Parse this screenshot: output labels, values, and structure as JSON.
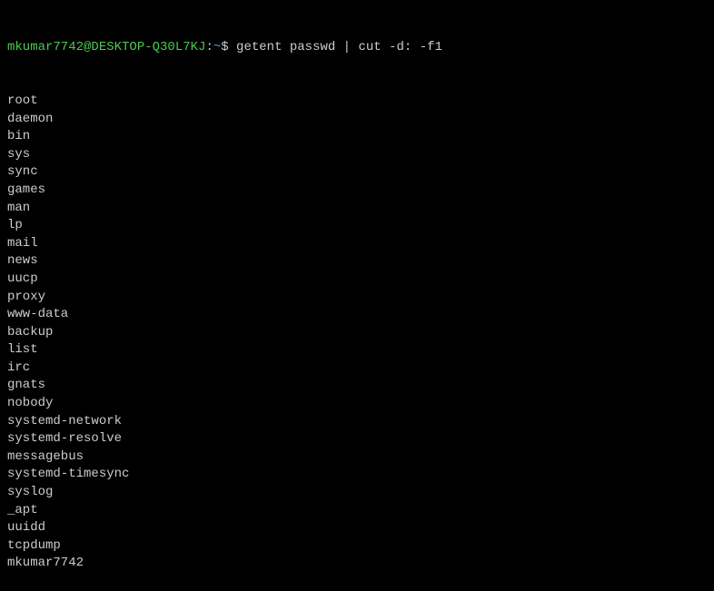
{
  "prompt": {
    "user_host": "mkumar7742@DESKTOP-Q30L7KJ",
    "colon": ":",
    "path": "~",
    "dollar": "$",
    "command": " getent passwd | cut -d: -f1"
  },
  "output": [
    "root",
    "daemon",
    "bin",
    "sys",
    "sync",
    "games",
    "man",
    "lp",
    "mail",
    "news",
    "uucp",
    "proxy",
    "www-data",
    "backup",
    "list",
    "irc",
    "gnats",
    "nobody",
    "systemd-network",
    "systemd-resolve",
    "messagebus",
    "systemd-timesync",
    "syslog",
    "_apt",
    "uuidd",
    "tcpdump",
    "mkumar7742"
  ]
}
